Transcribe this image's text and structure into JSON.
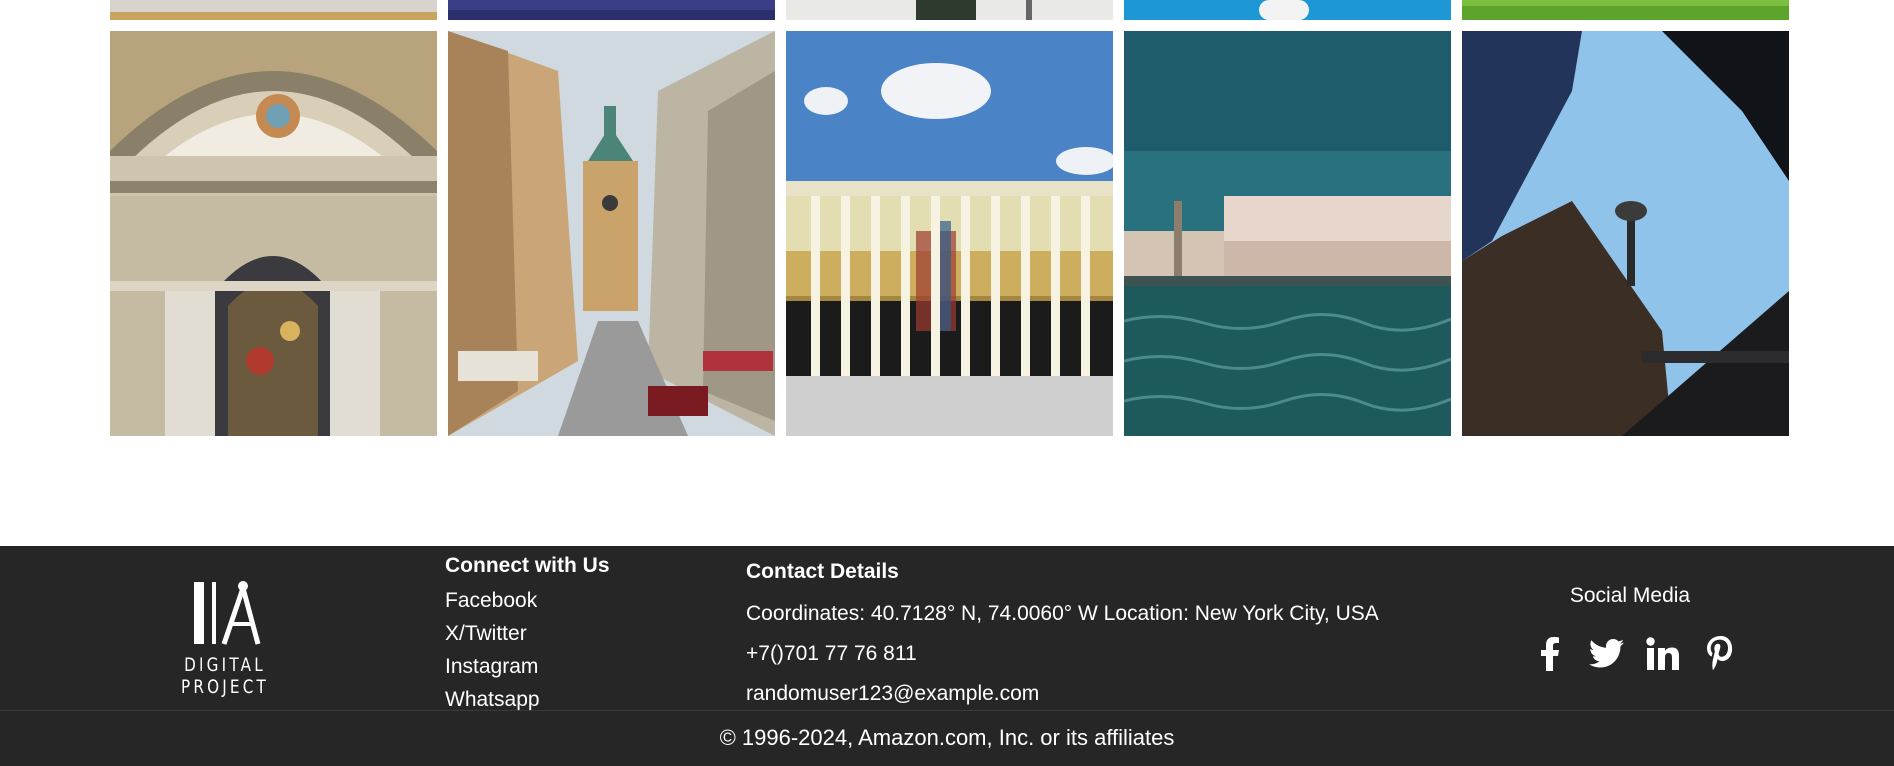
{
  "gallery": {
    "top_row": [
      {
        "alt": "food"
      },
      {
        "alt": "water"
      },
      {
        "alt": "plant"
      },
      {
        "alt": "lighthouse"
      },
      {
        "alt": "grass"
      }
    ],
    "bottom_row": [
      {
        "alt": "church-interior"
      },
      {
        "alt": "stockholm-street"
      },
      {
        "alt": "colonnade-building"
      },
      {
        "alt": "venice-palace"
      },
      {
        "alt": "skyscrapers-tower"
      }
    ]
  },
  "footer": {
    "logo_text": "DIGITAL PROJECT",
    "connect": {
      "title": "Connect with Us",
      "links": [
        "Facebook",
        "X/Twitter",
        "Instagram",
        "Whatsapp"
      ]
    },
    "contact": {
      "title": "Contact Details",
      "coordinates": "Coordinates: 40.7128° N, 74.0060° W Location: New York City, USA",
      "phone": "+7()701 77 76 811",
      "email": "randomuser123@example.com"
    },
    "social": {
      "title": "Social Media",
      "icons": [
        "facebook-icon",
        "twitter-icon",
        "linkedin-icon",
        "pinterest-icon"
      ]
    },
    "copyright": "© 1996-2024, Amazon.com, Inc. or its affiliates"
  },
  "colors": {
    "footer_bg": "#262626",
    "text": "#ffffff"
  }
}
